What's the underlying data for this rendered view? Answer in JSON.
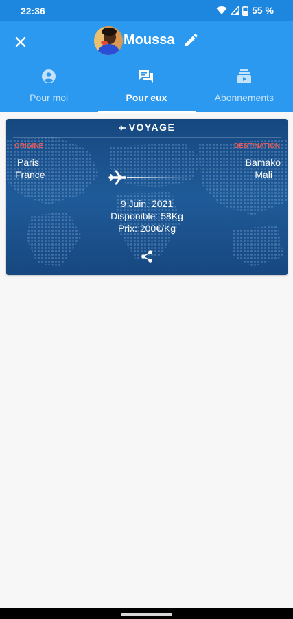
{
  "status_bar": {
    "time": "22:36",
    "battery": "55 %"
  },
  "header": {
    "name": "Moussa"
  },
  "tabs": [
    {
      "label": "Pour moi",
      "icon": "account-circle-icon"
    },
    {
      "label": "Pour eux",
      "icon": "forum-icon"
    },
    {
      "label": "Abonnements",
      "icon": "subscriptions-icon"
    }
  ],
  "active_tab": "Pour eux",
  "trip": {
    "title": "VOYAGE",
    "origin_label": "ORIGINE",
    "destination_label": "DESTINATION",
    "origin_city": "Paris",
    "origin_country": "France",
    "destination_city": "Bamako",
    "destination_country": "Mali",
    "date": "9 Juin, 2021",
    "available": "Disponible: 58Kg",
    "price": "Prix: 200€/Kg"
  },
  "colors": {
    "header": "#2b99f0",
    "status_bar": "#1d87e0",
    "card": "#1a4f8a",
    "label_red": "#e25a5a"
  }
}
